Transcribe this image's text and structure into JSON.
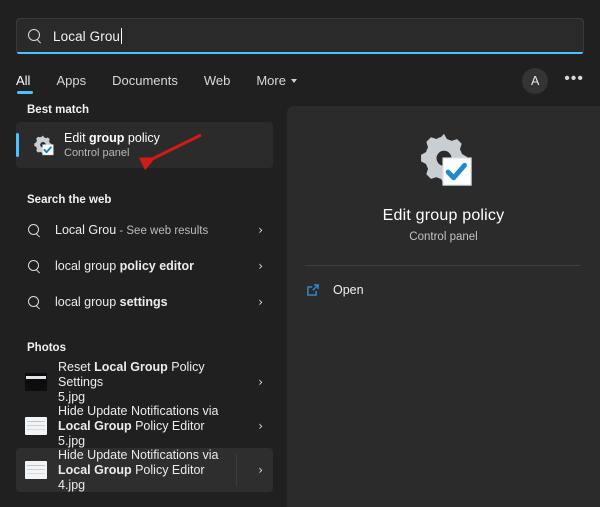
{
  "search": {
    "value": "Local Grou",
    "icon": "search-icon",
    "has_caret": true
  },
  "tabs": [
    {
      "label": "All",
      "active": true
    },
    {
      "label": "Apps",
      "active": false
    },
    {
      "label": "Documents",
      "active": false
    },
    {
      "label": "Web",
      "active": false
    },
    {
      "label": "More",
      "active": false,
      "icon": "chevron-down-icon"
    }
  ],
  "header_actions": {
    "avatar_letter": "A",
    "more_label": "•••"
  },
  "sections": {
    "best_match": {
      "heading": "Best match",
      "item": {
        "title_prefix": "Edit ",
        "title_bold": "group",
        "title_suffix": " policy",
        "subtitle": "Control panel",
        "icon": "gear-check-icon",
        "selected": true
      }
    },
    "search_web": {
      "heading": "Search the web",
      "items": [
        {
          "text_plain": "Local Grou",
          "text_bold": "",
          "suffix_dim": " - See web results",
          "icon": "search-icon",
          "chevron": "›"
        },
        {
          "text_plain": "local group ",
          "text_bold": "policy editor",
          "suffix_dim": "",
          "icon": "search-icon",
          "chevron": "›"
        },
        {
          "text_plain": "local group ",
          "text_bold": "settings",
          "suffix_dim": "",
          "icon": "search-icon",
          "chevron": "›"
        }
      ]
    },
    "photos": {
      "heading": "Photos",
      "items": [
        {
          "line1_plain": "Reset ",
          "line1_bold": "Local Group",
          "line1_suffix": " Policy Settings",
          "line2_bold": "",
          "line2_plain": "5.jpg",
          "thumb": "dark",
          "chevron": "›",
          "hovered": false
        },
        {
          "line1_plain": "Hide Update Notifications via",
          "line1_bold": "",
          "line1_suffix": "",
          "line2_bold": "Local Group",
          "line2_plain": " Policy Editor 5.jpg",
          "thumb": "light",
          "chevron": "›",
          "hovered": false
        },
        {
          "line1_plain": "Hide Update Notifications via",
          "line1_bold": "",
          "line1_suffix": "",
          "line2_bold": "Local Group",
          "line2_plain": " Policy Editor 4.jpg",
          "thumb": "light",
          "chevron": "›",
          "hovered": true
        }
      ]
    }
  },
  "preview": {
    "icon": "gear-check-icon",
    "title": "Edit group policy",
    "subtitle": "Control panel",
    "action": {
      "label": "Open",
      "icon": "open-external-icon"
    }
  },
  "annotation": {
    "type": "arrow",
    "color": "#d01b17"
  },
  "colors": {
    "background": "#202020",
    "panel": "#2b2b2b",
    "accent": "#4cc2ff",
    "text": "#ffffff",
    "text_dim": "#bdbdbd",
    "annotation_red": "#d01b17"
  }
}
